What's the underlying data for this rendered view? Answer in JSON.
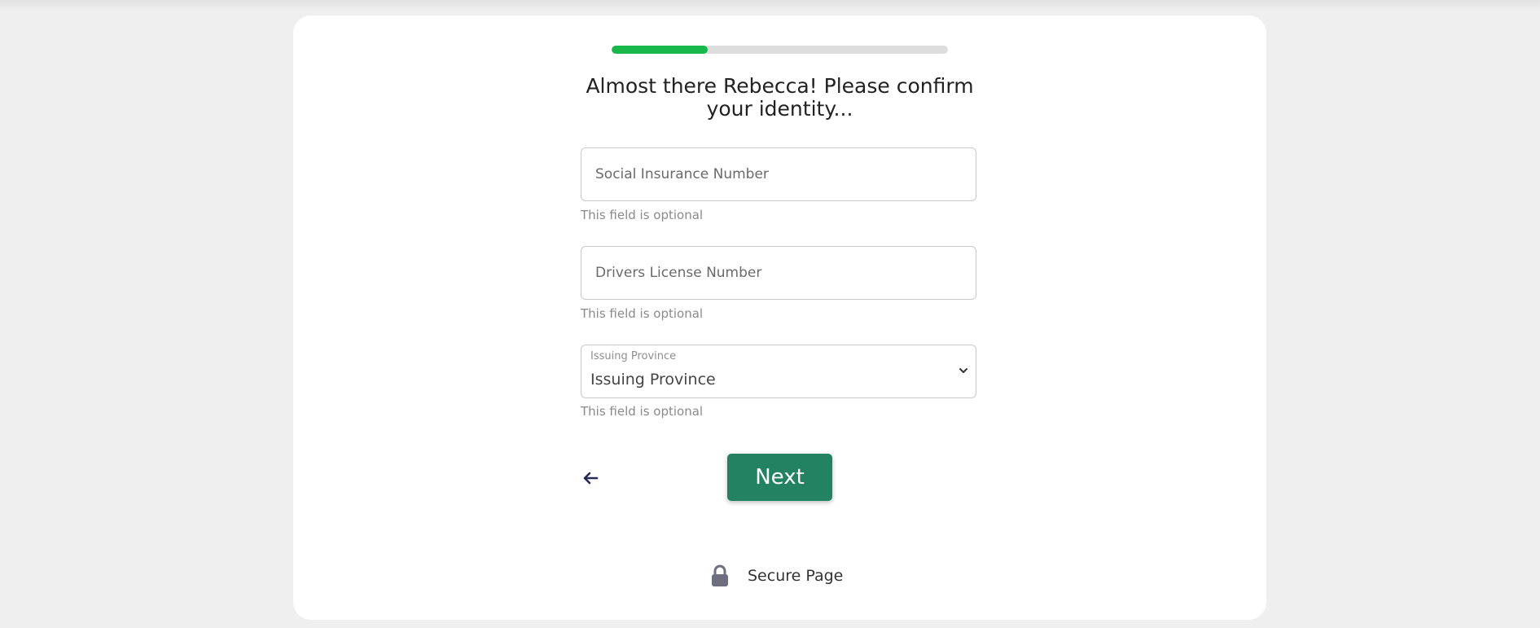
{
  "progress": {
    "value_fraction": 0.286,
    "fill_color": "#19b84a",
    "track_color": "#dddddd"
  },
  "header": {
    "title": "Almost there Rebecca! Please confirm your identity..."
  },
  "form": {
    "sin": {
      "placeholder": "Social Insurance Number",
      "value": "",
      "help": "This field is optional"
    },
    "license": {
      "placeholder": "Drivers License Number",
      "value": "",
      "help": "This field is optional"
    },
    "province": {
      "label": "Issuing Province",
      "selected": "Issuing Province",
      "help": "This field is optional"
    }
  },
  "actions": {
    "back_icon": "arrow-left-icon",
    "next_label": "Next",
    "next_color": "#238262"
  },
  "footer": {
    "secure_label": "Secure Page",
    "icon": "lock-icon"
  }
}
